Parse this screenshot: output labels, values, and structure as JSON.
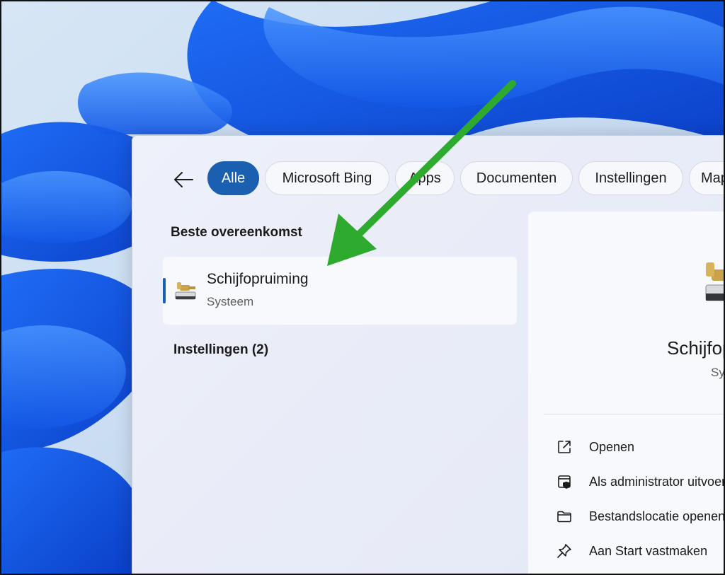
{
  "search": {
    "back_icon": "arrow-left-icon",
    "filters": [
      {
        "label": "Alle",
        "active": true
      },
      {
        "label": "Microsoft Bing",
        "active": false
      },
      {
        "label": "Apps",
        "active": false
      },
      {
        "label": "Documenten",
        "active": false
      },
      {
        "label": "Instellingen",
        "active": false
      },
      {
        "label": "Map",
        "active": false
      }
    ]
  },
  "results": {
    "best_match_heading": "Beste overeenkomst",
    "best_match": {
      "name": "Schijfopruiming",
      "type": "Systeem",
      "icon": "disk-cleanup-icon"
    },
    "settings_heading": "Instellingen (2)"
  },
  "detail": {
    "title": "Schijfopruiming",
    "subtitle": "Systeem",
    "actions": [
      {
        "label": "Openen",
        "icon": "open-external-icon"
      },
      {
        "label": "Als administrator uitvoeren",
        "icon": "run-as-admin-icon"
      },
      {
        "label": "Bestandslocatie openen",
        "icon": "folder-icon"
      },
      {
        "label": "Aan Start vastmaken",
        "icon": "pin-icon"
      }
    ]
  },
  "colors": {
    "accent": "#1a5fb0",
    "annotation_arrow": "#2eaa2e"
  }
}
